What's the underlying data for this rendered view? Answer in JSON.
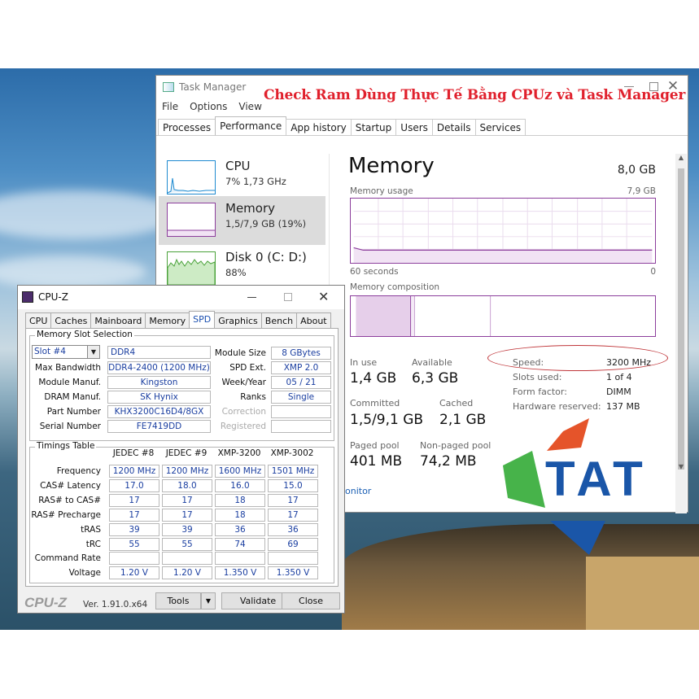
{
  "overlay_caption": "Check Ram Dùng Thực Tế Bằng CPUz và Task Manager",
  "task_manager": {
    "title": "Task Manager",
    "menu": [
      "File",
      "Options",
      "View"
    ],
    "tabs": [
      "Processes",
      "Performance",
      "App history",
      "Startup",
      "Users",
      "Details",
      "Services"
    ],
    "active_tab": "Performance",
    "sidebar": [
      {
        "name": "CPU",
        "sub": "7% 1,73 GHz"
      },
      {
        "name": "Memory",
        "sub": "1,5/7,9 GB (19%)"
      },
      {
        "name": "Disk 0 (C: D:)",
        "sub": "88%"
      }
    ],
    "memory": {
      "title": "Memory",
      "total": "8,0 GB",
      "usage_label": "Memory usage",
      "usage_max": "7,9 GB",
      "time_label": "60 seconds",
      "time_min": "0",
      "composition_label": "Memory composition",
      "in_use_label": "In use",
      "in_use": "1,4 GB",
      "available_label": "Available",
      "available": "6,3 GB",
      "committed_label": "Committed",
      "committed": "1,5/9,1 GB",
      "cached_label": "Cached",
      "cached": "2,1 GB",
      "paged_label": "Paged pool",
      "paged": "401 MB",
      "nonpaged_label": "Non-paged pool",
      "nonpaged": "74,2 MB",
      "speed_label": "Speed:",
      "speed": "3200 MHz",
      "slots_label": "Slots used:",
      "slots": "1 of 4",
      "form_label": "Form factor:",
      "form": "DIMM",
      "hw_label": "Hardware reserved:",
      "hw": "137 MB"
    },
    "open_monitor": "onitor"
  },
  "logo": {
    "text": "TAT"
  },
  "cpuz": {
    "title": "CPU-Z",
    "tabs": [
      "CPU",
      "Caches",
      "Mainboard",
      "Memory",
      "SPD",
      "Graphics",
      "Bench",
      "About"
    ],
    "active_tab": "SPD",
    "slot_group": "Memory Slot Selection",
    "slot": "Slot #4",
    "type": "DDR4",
    "fields_left": [
      {
        "label": "Max Bandwidth",
        "value": "DDR4-2400 (1200 MHz)"
      },
      {
        "label": "Module Manuf.",
        "value": "Kingston"
      },
      {
        "label": "DRAM Manuf.",
        "value": "SK Hynix"
      },
      {
        "label": "Part Number",
        "value": "KHX3200C16D4/8GX"
      },
      {
        "label": "Serial Number",
        "value": "FE7419DD"
      }
    ],
    "fields_right": [
      {
        "label": "Module Size",
        "value": "8 GBytes"
      },
      {
        "label": "SPD Ext.",
        "value": "XMP 2.0"
      },
      {
        "label": "Week/Year",
        "value": "05 / 21"
      },
      {
        "label": "Ranks",
        "value": "Single"
      },
      {
        "label": "Correction",
        "value": ""
      },
      {
        "label": "Registered",
        "value": ""
      }
    ],
    "timings_group": "Timings Table",
    "timing_headers": [
      "JEDEC #8",
      "JEDEC #9",
      "XMP-3200",
      "XMP-3002"
    ],
    "timing_rows": [
      {
        "label": "Frequency",
        "values": [
          "1200 MHz",
          "1200 MHz",
          "1600 MHz",
          "1501 MHz"
        ]
      },
      {
        "label": "CAS# Latency",
        "values": [
          "17.0",
          "18.0",
          "16.0",
          "15.0"
        ]
      },
      {
        "label": "RAS# to CAS#",
        "values": [
          "17",
          "17",
          "18",
          "17"
        ]
      },
      {
        "label": "RAS# Precharge",
        "values": [
          "17",
          "17",
          "18",
          "17"
        ]
      },
      {
        "label": "tRAS",
        "values": [
          "39",
          "39",
          "36",
          "36"
        ]
      },
      {
        "label": "tRC",
        "values": [
          "55",
          "55",
          "74",
          "69"
        ]
      },
      {
        "label": "Command Rate",
        "values": [
          "",
          "",
          "",
          ""
        ]
      },
      {
        "label": "Voltage",
        "values": [
          "1.20 V",
          "1.20 V",
          "1.350 V",
          "1.350 V"
        ]
      }
    ],
    "brand": "CPU-Z",
    "version": "Ver. 1.91.0.x64",
    "tools_button": "Tools",
    "validate_button": "Validate",
    "close_button": "Close"
  }
}
